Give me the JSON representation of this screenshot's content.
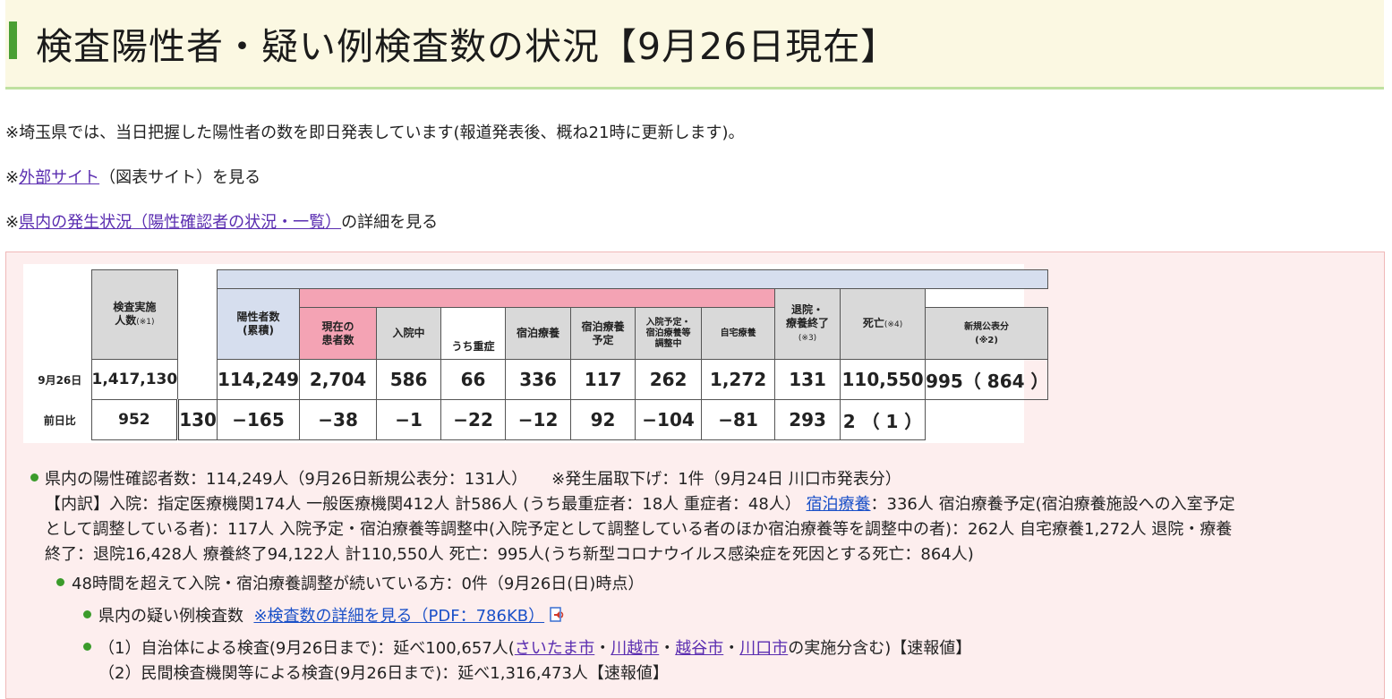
{
  "header": {
    "title": "検査陽性者・疑い例検査数の状況【9月26日現在】"
  },
  "notes": {
    "line1": "※埼玉県では、当日把握した陽性者の数を即日発表しています(報道発表後、概ね21時に更新します)。",
    "line2_prefix": "※",
    "line2_link": "外部サイト",
    "line2_suffix": "（図表サイト）を見る",
    "line3_prefix": "※",
    "line3_link": "県内の発生状況（陽性確認者の状況・一覧）",
    "line3_suffix": "の詳細を見る"
  },
  "table": {
    "headers": {
      "tested": "検査実施",
      "tested2": "人数",
      "tested_note": "(※1)",
      "positive": "陽性者数",
      "positive2": "(累積)",
      "current": "現在の",
      "current2": "患者数",
      "hospital": "入院中",
      "severe": "うち重症",
      "lodging": "宿泊療養",
      "lodging_plan": "宿泊療養",
      "lodging_plan2": "予定",
      "adjust1": "入院予定・",
      "adjust2": "宿泊療養等",
      "adjust3": "調整中",
      "home": "自宅療養",
      "new": "新規公表分",
      "new2": "(※2)",
      "recovered": "退院・",
      "recovered2": "療養終了",
      "recovered_note": "(※3)",
      "death": "死亡",
      "death_note": "(※4)"
    },
    "rows": [
      {
        "label": "9月26日",
        "tested": "1,417,130",
        "positive": "114,249",
        "current": "2,704",
        "hospital": "586",
        "severe": "66",
        "lodging": "336",
        "lodging_plan": "117",
        "adjust": "262",
        "home": "1,272",
        "new": "131",
        "recovered": "110,550",
        "death": "995（ 864 ）"
      },
      {
        "label": "前日比",
        "tested": "952",
        "positive": "130",
        "current": "−165",
        "hospital": "−38",
        "severe": "−1",
        "lodging": "−22",
        "lodging_plan": "−12",
        "adjust": "92",
        "home": "−104",
        "new": "−81",
        "recovered": "293",
        "death": "2 （ 1 ）"
      }
    ]
  },
  "details": {
    "b1": "県内の陽性確認者数：114,249人（9月26日新規公表分：131人）　　※発生届取下げ：1件（9月24日 川口市発表分）",
    "b1_l2_pre": "【内訳】入院：指定医療機関174人 一般医療機関412人 計586人 (うち最重症者：18人 重症者：48人）",
    "b1_l2_link": "宿泊療養",
    "b1_l2_post": "：336人 宿泊療養予定(宿泊療養施設への入室予定",
    "b1_l3": "として調整している者)：117人 入院予定・宿泊療養等調整中(入院予定として調整している者のほか宿泊療養等を調整中の者)：262人 自宅療養1,272人 退院・療養",
    "b1_l4": "終了：退院16,428人 療養終了94,122人 計110,550人 死亡：995人(うち新型コロナウイルス感染症を死因とする死亡：864人)",
    "b2": "48時間を超えて入院・宿泊療養調整が続いている方：0件（9月26日(日)時点）",
    "b3_pre": "県内の疑い例検査数",
    "b3_link": "※検査数の詳細を見る（PDF：786KB）",
    "b4_pre": "（1）自治体による検査(9月26日まで)：延べ100,657人(",
    "b4_link1": "さいたま市",
    "b4_sep1": "・",
    "b4_link2": "川越市",
    "b4_sep2": "・",
    "b4_link3": "越谷市",
    "b4_sep3": "・",
    "b4_link4": "川口市",
    "b4_post": "の実施分含む)【速報値】",
    "b5": "（2）民間検査機関等による検査(9月26日まで)：延べ1,316,473人【速報値】"
  },
  "colors": {
    "accent": "#4a9f34",
    "title_bg": "#fbf8e2",
    "panel_bg": "#fdeeee",
    "link_purple": "#5a2db0",
    "link_blue": "#1a50c8",
    "header_pink": "#f4a3b4",
    "header_lavender": "#d6deee"
  },
  "icons": {
    "pdf": "speaker-pdf-icon",
    "bullet": "green-dot-bullet-icon"
  }
}
